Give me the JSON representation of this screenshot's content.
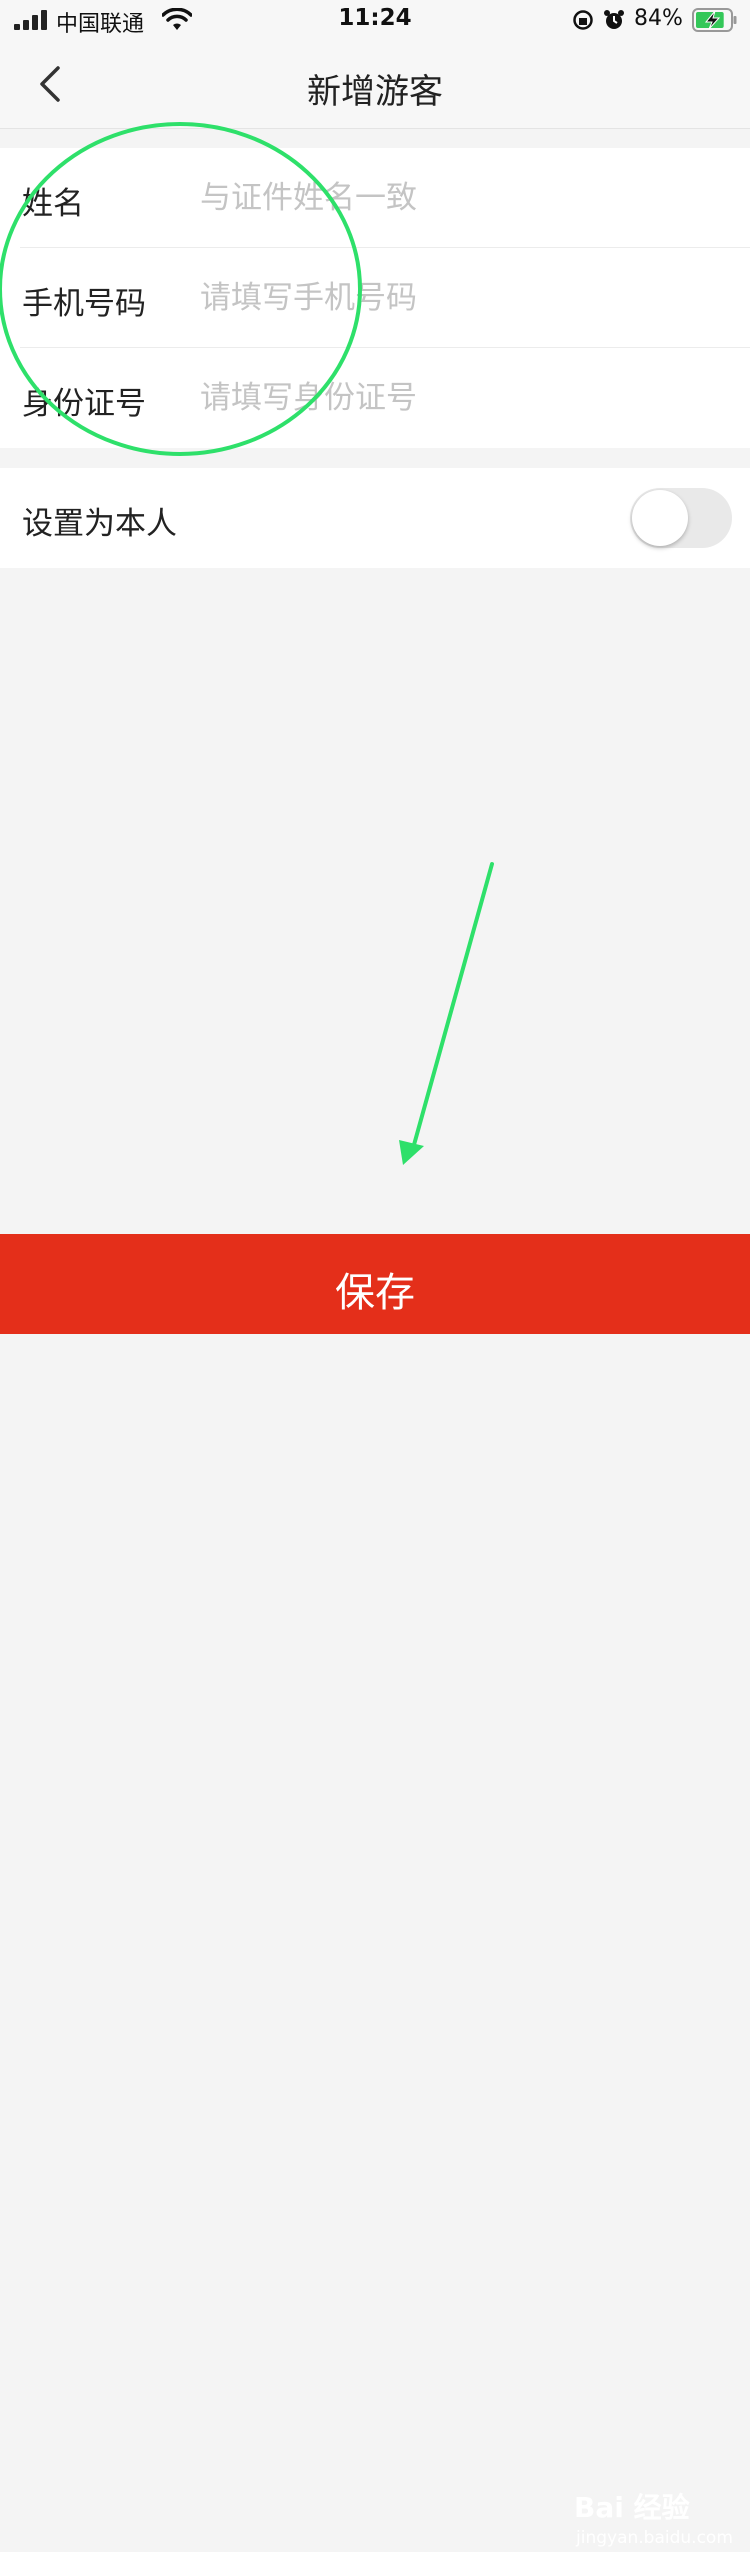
{
  "status_bar": {
    "carrier": "中国联通",
    "time": "11:24",
    "battery_percent": "84%",
    "battery_level": 0.84
  },
  "nav": {
    "title": "新增游客"
  },
  "form": {
    "fields": [
      {
        "label": "姓名",
        "value": "",
        "placeholder": "与证件姓名一致"
      },
      {
        "label": "手机号码",
        "value": "",
        "placeholder": "请填写手机号码"
      },
      {
        "label": "身份证号",
        "value": "",
        "placeholder": "请填写身份证号"
      }
    ]
  },
  "set_self": {
    "label": "设置为本人",
    "enabled": false
  },
  "save_button": {
    "label": "保存"
  },
  "watermark": {
    "logo": "Bai 经验",
    "url": "jingyan.baidu.com"
  },
  "colors": {
    "accent": "#e42f1a",
    "annotation": "#2ee06a",
    "placeholder": "#c4c4c4"
  }
}
